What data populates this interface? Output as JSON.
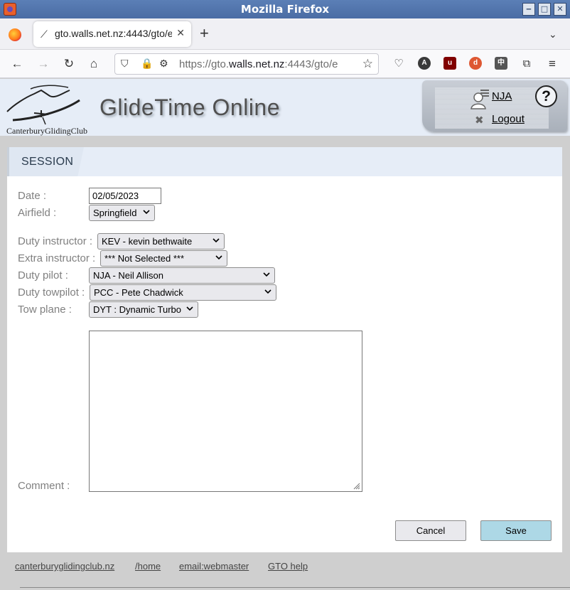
{
  "window": {
    "title": "Mozilla Firefox"
  },
  "browser": {
    "tab_title": "gto.walls.net.nz:4443/gto/e",
    "url_prefix": "https://gto.",
    "url_host": "walls.net.nz",
    "url_suffix": ":4443/gto/e",
    "new_tab": "+",
    "close_tab": "✕"
  },
  "header": {
    "logo_text": "CanterburyGlidingClub",
    "site_title": "GlideTime Online",
    "user": "NJA",
    "logout": "Logout",
    "help": "?"
  },
  "panel": {
    "title": "SESSION"
  },
  "form": {
    "date_label": "Date :",
    "date_value": "02/05/2023",
    "airfield_label": "Airfield :",
    "airfield_value": "Springfield",
    "duty_instructor_label": "Duty instructor :",
    "duty_instructor_value": "KEV - kevin bethwaite",
    "extra_instructor_label": "Extra instructor :",
    "extra_instructor_value": "*** Not Selected ***",
    "duty_pilot_label": "Duty pilot :",
    "duty_pilot_value": "NJA - Neil Allison",
    "duty_towpilot_label": "Duty towpilot :",
    "duty_towpilot_value": "PCC - Pete Chadwick",
    "tow_plane_label": "Tow plane :",
    "tow_plane_value": "DYT : Dynamic Turbo",
    "comment_label": "Comment :",
    "comment_value": ""
  },
  "buttons": {
    "cancel": "Cancel",
    "save": "Save"
  },
  "footer": {
    "links": [
      "canterburyglidingclub.nz",
      "/home",
      "email:webmaster",
      "GTO help"
    ]
  },
  "colors": {
    "save_button": "#add8e6",
    "header_bg": "#e6edf7",
    "titlebar": "#4a6ca4"
  }
}
